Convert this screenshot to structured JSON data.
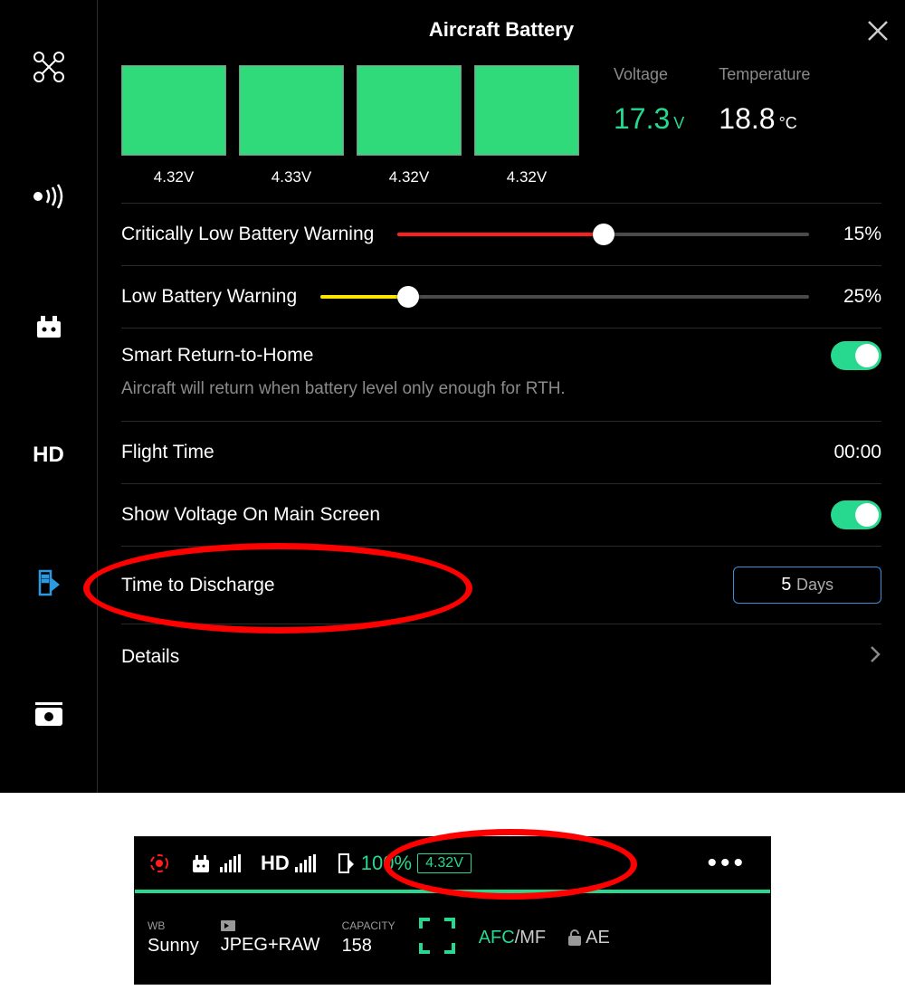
{
  "header": {
    "title": "Aircraft Battery"
  },
  "cells": [
    {
      "voltage": "4.32V"
    },
    {
      "voltage": "4.33V"
    },
    {
      "voltage": "4.32V"
    },
    {
      "voltage": "4.32V"
    }
  ],
  "stats": {
    "voltage_label": "Voltage",
    "voltage_value": "17.3",
    "voltage_unit": "V",
    "temp_label": "Temperature",
    "temp_value": "18.8",
    "temp_unit": "°C"
  },
  "sliders": {
    "critical": {
      "label": "Critically Low Battery Warning",
      "value": "15%",
      "pct": 50,
      "color": "#ff1e1e"
    },
    "low": {
      "label": "Low Battery Warning",
      "value": "25%",
      "pct": 18,
      "color": "#ffe600"
    }
  },
  "smart_rth": {
    "label": "Smart Return-to-Home",
    "sub": "Aircraft will return when battery level only enough for RTH."
  },
  "flight_time": {
    "label": "Flight Time",
    "value": "00:00"
  },
  "show_voltage": {
    "label": "Show Voltage On Main Screen"
  },
  "discharge": {
    "label": "Time to Discharge",
    "value": "5",
    "unit": "Days"
  },
  "details": {
    "label": "Details"
  },
  "hud": {
    "hd_label": "HD",
    "battery_pct": "100%",
    "battery_volt": "4.32V",
    "wb_label": "WB",
    "wb_value": "Sunny",
    "format_value": "JPEG+RAW",
    "capacity_label": "CAPACITY",
    "capacity_value": "158",
    "afc": "AFC",
    "mf": "/MF",
    "ae": "AE"
  },
  "icons": {
    "sidebar_hd": "HD"
  }
}
